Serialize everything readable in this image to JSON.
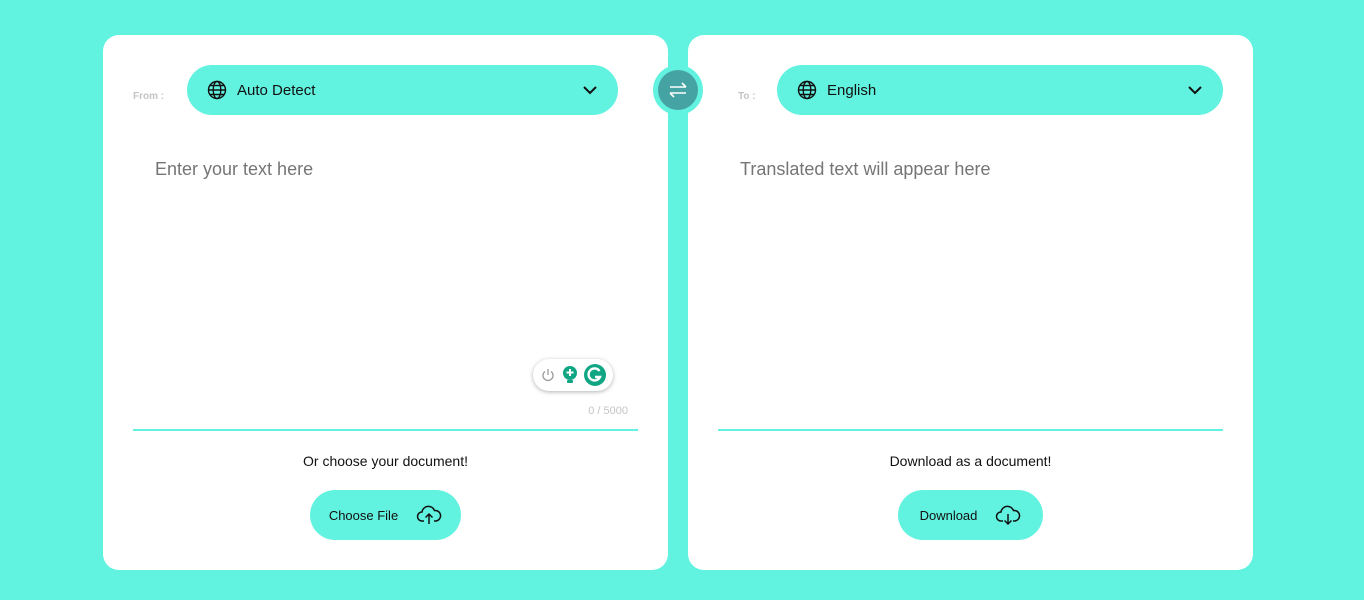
{
  "source": {
    "label": "From :",
    "language": "Auto Detect",
    "placeholder": "Enter your text here",
    "counter": "0 / 5000",
    "caption": "Or choose your document!",
    "button": "Choose File"
  },
  "target": {
    "label": "To :",
    "language": "English",
    "placeholder": "Translated text will appear here",
    "caption": "Download as a document!",
    "button": "Download"
  },
  "colors": {
    "accent": "#62f2e0",
    "swap": "#46a3a3",
    "grammarly": "#11a683"
  }
}
